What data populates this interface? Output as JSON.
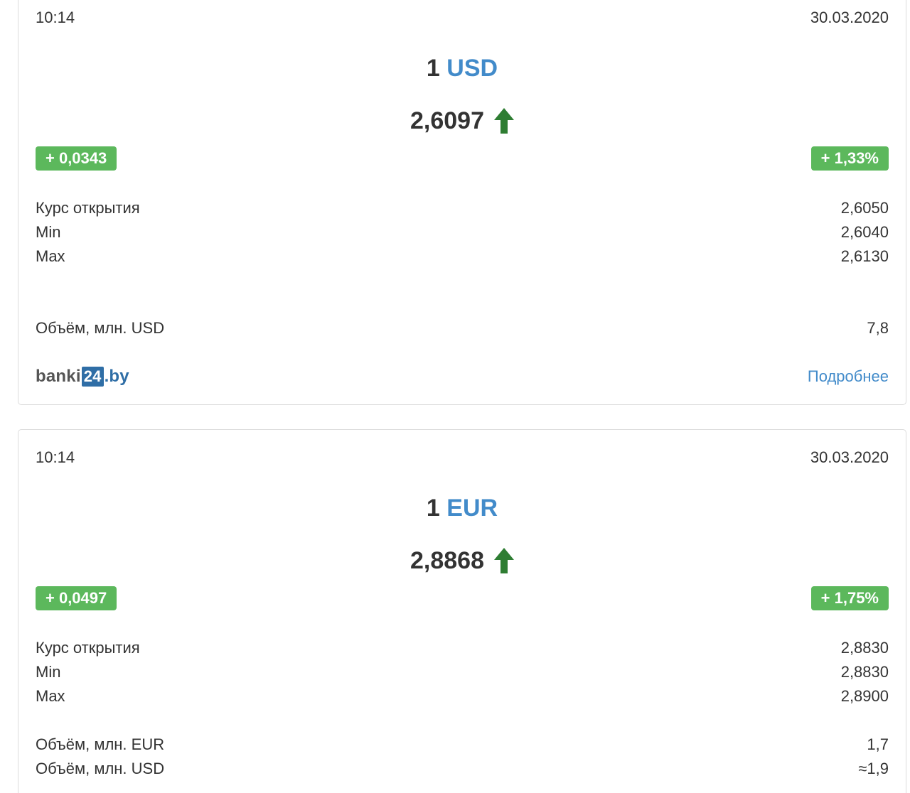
{
  "cards": [
    {
      "time": "10:14",
      "date": "30.03.2020",
      "amount": "1",
      "currency": "USD",
      "rate": "2,6097",
      "trend_icon": "arrow-up-icon",
      "change_abs": "+ 0,0343",
      "change_pct": "+ 1,33%",
      "stats": [
        {
          "label": "Курс открытия",
          "value": "2,6050"
        },
        {
          "label": "Min",
          "value": "2,6040"
        },
        {
          "label": "Max",
          "value": "2,6130"
        }
      ],
      "volumes": [
        {
          "label": "Объём, млн. USD",
          "value": "7,8"
        }
      ],
      "logo": {
        "prefix": "banki",
        "num": "24",
        "suffix": ".by"
      },
      "more_link": "Подробнее"
    },
    {
      "time": "10:14",
      "date": "30.03.2020",
      "amount": "1",
      "currency": "EUR",
      "rate": "2,8868",
      "trend_icon": "arrow-up-icon",
      "change_abs": "+ 0,0497",
      "change_pct": "+ 1,75%",
      "stats": [
        {
          "label": "Курс открытия",
          "value": "2,8830"
        },
        {
          "label": "Min",
          "value": "2,8830"
        },
        {
          "label": "Max",
          "value": "2,8900"
        }
      ],
      "volumes": [
        {
          "label": "Объём, млн. EUR",
          "value": "1,7"
        },
        {
          "label": "Объём, млн. USD",
          "value": "≈1,9"
        }
      ]
    }
  ],
  "colors": {
    "accent": "#428bca",
    "badge_green": "#5cb85c",
    "arrow_green": "#2e7d32",
    "text": "#333333"
  }
}
